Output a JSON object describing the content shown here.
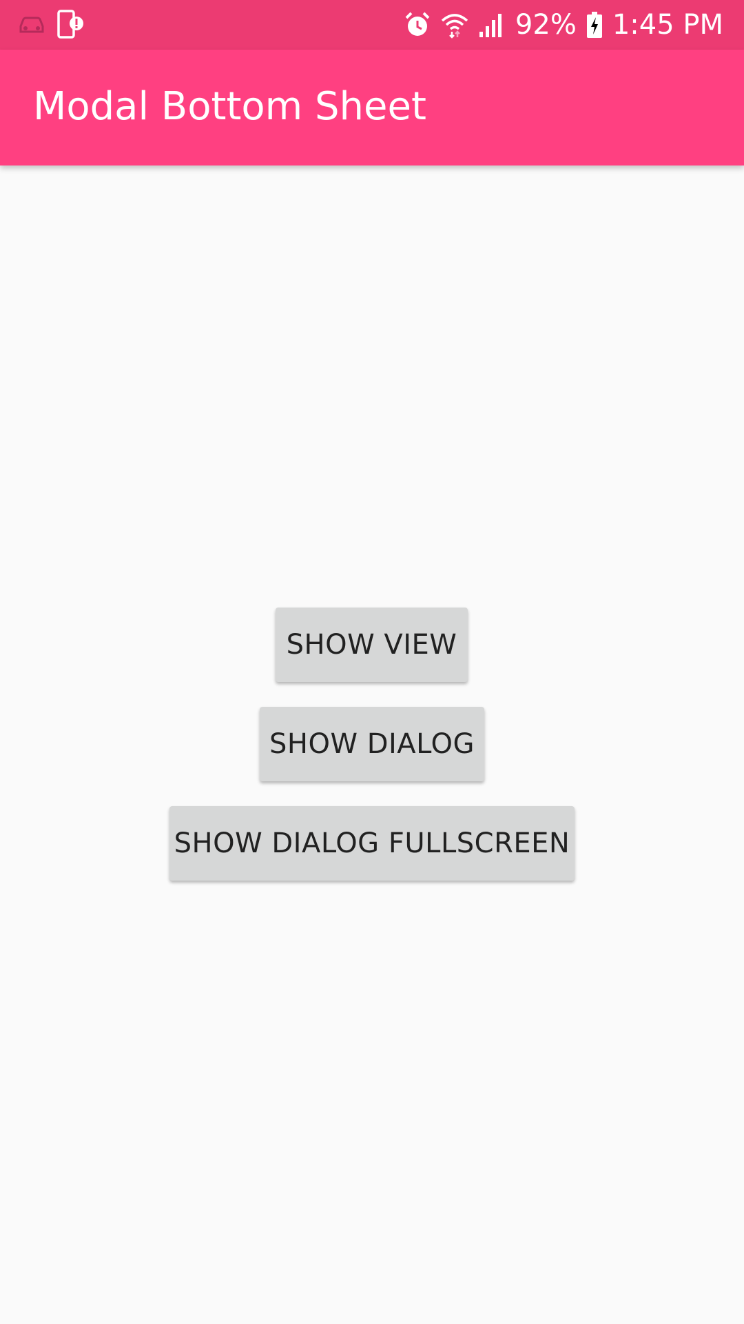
{
  "status_bar": {
    "left_icons": [
      "car-mode-icon",
      "phone-alert-icon"
    ],
    "right_icons": [
      "alarm-icon",
      "wifi-icon",
      "signal-icon",
      "battery-charging-icon"
    ],
    "battery": "92%",
    "time": "1:45 PM"
  },
  "app_bar": {
    "title": "Modal Bottom Sheet"
  },
  "buttons": {
    "show_view": "SHOW VIEW",
    "show_dialog": "SHOW DIALOG",
    "show_dialog_fullscreen": "SHOW DIALOG FULLSCREEN"
  },
  "colors": {
    "status_bar": "#ec3b72",
    "app_bar": "#ff4081",
    "background": "#fafafa",
    "button": "#d6d7d7",
    "button_text": "#212121"
  }
}
